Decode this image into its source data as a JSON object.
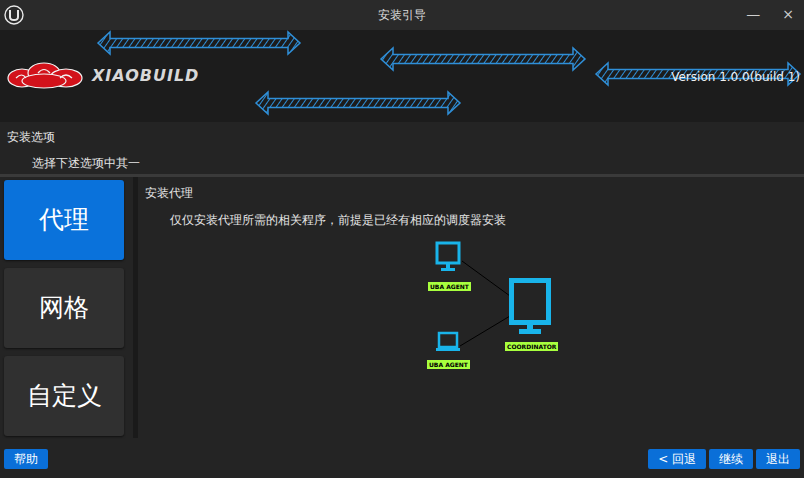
{
  "window": {
    "title": "安装引导",
    "minimize": "—",
    "close": "×"
  },
  "header": {
    "logo": "XIAOBUILD",
    "version": "Version 1.0.0(build 1)"
  },
  "section": {
    "title": "安装选项",
    "subtitle": "选择下述选项中其一"
  },
  "options": [
    {
      "label": "代理",
      "selected": true
    },
    {
      "label": "网格",
      "selected": false
    },
    {
      "label": "自定义",
      "selected": false
    }
  ],
  "detail": {
    "title": "安装代理",
    "description": "仅仅安装代理所需的相关程序，前提是已经有相应的调度器安装"
  },
  "diagram": {
    "nodes": [
      {
        "label": "UBA AGENT",
        "kind": "desktop"
      },
      {
        "label": "UBA AGENT",
        "kind": "laptop"
      },
      {
        "label": "COORDINATOR",
        "kind": "server"
      }
    ]
  },
  "footer": {
    "help": "帮助",
    "buttons": [
      "< 回退",
      "继续",
      "退出"
    ]
  }
}
